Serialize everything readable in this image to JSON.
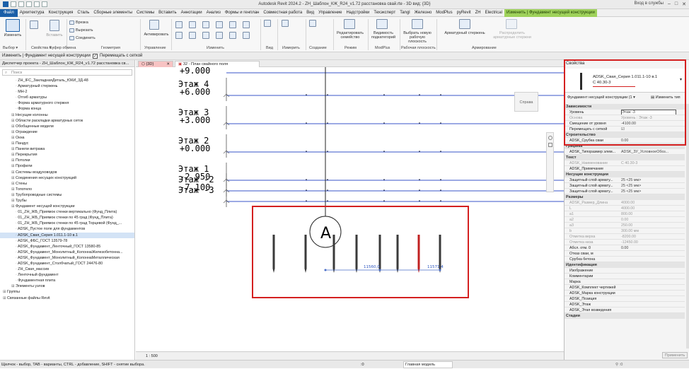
{
  "window": {
    "title": "Autodesk Revit 2024.2 - ZH_Шаблон_КЖ_R24_v1.72 расстановка свай.rte - 3D вид: {3D}",
    "signin": "Вход в службы"
  },
  "menu": [
    "Файл",
    "Архитектура",
    "Конструкция",
    "Сталь",
    "Сборные элементы",
    "Системы",
    "Вставить",
    "Аннотации",
    "Анализ",
    "Формы и генплан",
    "Совместная работа",
    "Вид",
    "Управление",
    "Надстройки",
    "Техэксперт",
    "Tangl",
    "Железно",
    "ModPlus",
    "pyRevit",
    "ZH",
    "Electrical",
    "Изменить | Фундамент несущей конструкции"
  ],
  "ribbon": {
    "modify": "Изменить",
    "paste": "Вставить",
    "cut": "Вырезать",
    "join": "Соединить",
    "cope": "Врезка",
    "activate": "Активировать",
    "groups": {
      "select": "Выбор",
      "properties": "Свойства",
      "clipboard": "Буфер обмена",
      "geometry": "Геометрия",
      "control": "Управление",
      "modify": "Изменить",
      "view": "Вид",
      "measure": "Измерить",
      "create": "Создание",
      "mode": "Режим",
      "modplus": "ModPlus",
      "workplane": "Рабочая плоскость",
      "reinforcement": "Армирование"
    },
    "edit_family": "Редактировать семейство",
    "host_visibility": "Видимость подкатегорий",
    "pick_plane": "Выбрать новую рабочую плоскость",
    "rebar": "Арматурный стержень",
    "distribute_rebar": "Распределить арматурные стержни"
  },
  "context_bar": {
    "label": "Изменить | Фундамент несущей конструкции",
    "checkbox": "Перемещать с сеткой",
    "checked": true
  },
  "browser": {
    "title": "Диспетчер проекта - ZH_Шаблон_КЖ_R24_v1.72 расстановка св...",
    "search_placeholder": "Поиск",
    "items": [
      {
        "text": "ZH_IFC_ЗакладнаяДеталь_ЮКИ_3Д-48",
        "indent": 3
      },
      {
        "text": "Арматурный стержень",
        "indent": 3
      },
      {
        "text": "МН-2",
        "indent": 3
      },
      {
        "text": "Отгиб арматуры",
        "indent": 3
      },
      {
        "text": "Форма арматурного стержня",
        "indent": 3
      },
      {
        "text": "Форма конца",
        "indent": 3
      },
      {
        "text": "Несущие колонны",
        "indent": 2
      },
      {
        "text": "Области раскладки арматурных сеток",
        "indent": 2
      },
      {
        "text": "Обобщенные модели",
        "indent": 2
      },
      {
        "text": "Ограждение",
        "indent": 2
      },
      {
        "text": "Окна",
        "indent": 2
      },
      {
        "text": "Пандус",
        "indent": 2
      },
      {
        "text": "Панели витража",
        "indent": 2
      },
      {
        "text": "Перекрытия",
        "indent": 2
      },
      {
        "text": "Потолки",
        "indent": 2
      },
      {
        "text": "Профили",
        "indent": 2
      },
      {
        "text": "Системы воздуховодов",
        "indent": 2
      },
      {
        "text": "Соединения несущих конструкций",
        "indent": 2
      },
      {
        "text": "Стены",
        "indent": 2
      },
      {
        "text": "Топотело",
        "indent": 2
      },
      {
        "text": "Трубопроводные системы",
        "indent": 2
      },
      {
        "text": "Трубы",
        "indent": 2
      },
      {
        "text": "Фундамент несущей конструкции",
        "indent": 2
      },
      {
        "text": "01_ZH_ЖБ_Приямок стенки вертикально (Фунд_Плита)",
        "indent": 3
      },
      {
        "text": "01_ZH_ЖБ_Приямок стенки по 45 град (Фунд_Плита)",
        "indent": 3
      },
      {
        "text": "01_ZH_ЖБ_Приямок стенки по 45 град Торцевой (Фунд_...",
        "indent": 3
      },
      {
        "text": "ADSK_Пустое поле для фундаментов",
        "indent": 3
      },
      {
        "text": "ADSK_Свая_Серия 1.011.1-10 в.1",
        "indent": 3,
        "selected": true
      },
      {
        "text": "ADSK_ФБС_ГОСТ 13579-78",
        "indent": 3
      },
      {
        "text": "ADSK_Фундамент_Ленточный_ГОСТ 13580-85",
        "indent": 3
      },
      {
        "text": "ADSK_Фундамент_Монолитный_КолоннаЖелезобетонна...",
        "indent": 3
      },
      {
        "text": "ADSK_Фундамент_Монолитный_КолоннаМеталлическая",
        "indent": 3
      },
      {
        "text": "ADSK_Фундамент_Столбчатый_ГОСТ 24476-80",
        "indent": 3
      },
      {
        "text": "ZH_Свая_массив",
        "indent": 3
      },
      {
        "text": "Ленточный фундамент",
        "indent": 3
      },
      {
        "text": "Фундаментная плита",
        "indent": 3
      },
      {
        "text": "Элементы узлов",
        "indent": 2
      },
      {
        "text": "Группы",
        "indent": 0
      },
      {
        "text": "Связанные файлы Revit",
        "indent": 0
      }
    ]
  },
  "tabs": [
    "{3D}",
    "32 - План свайного поля"
  ],
  "canvas": {
    "levels": [
      {
        "name": "Этаж 4",
        "elev": "+6.000"
      },
      {
        "name": "Этаж 3",
        "elev": "+3.000"
      },
      {
        "name": "Этаж 2",
        "elev": "+0.000"
      },
      {
        "name": "Этаж 1",
        "elev": "-2.950"
      },
      {
        "name": "Этаж -2",
        "elev": "-7.100"
      },
      {
        "name": "Этаж -3",
        "elev": ""
      }
    ],
    "top_elev": "+9.000",
    "viewcube": "Справа",
    "grid_bubble": "A",
    "dim1": "11560,0",
    "dim2": "11571,4"
  },
  "view_status": {
    "scale": "1 : 500"
  },
  "status": {
    "hint": "Щелчок - выбор, TAB - варианты, CTRL - добавление, SHIFT - снятие выбора.",
    "model": "Главная модель",
    "zero": ":0"
  },
  "properties": {
    "title": "Свойства",
    "type_name": "ADSK_Свая_Серия 1.011.1-10 в.1",
    "type_sub": "С 40.30-3",
    "category": "Фундамент несущей конструкции (1",
    "edit_type": "Изменить тип",
    "apply": "Применить",
    "sections": [
      {
        "name": "Зависимости",
        "rows": [
          {
            "k": "Уровень",
            "v": "Этаж -3"
          },
          {
            "k": "Основа",
            "v": "Уровень : Этаж -3",
            "g": true
          },
          {
            "k": "Смещение от уровня",
            "v": "-4100.00"
          },
          {
            "k": "Перемещать с сеткой",
            "v": "☑"
          }
        ]
      },
      {
        "name": "Строительство",
        "rows": [
          {
            "k": "ADSK_Срубка сваи",
            "v": "0.00"
          }
        ]
      },
      {
        "name": "Графика",
        "rows": [
          {
            "k": "ADSK_Типоразмер элем...",
            "v": "ADSK_ЗУ_УсловноеОбоз..."
          }
        ]
      },
      {
        "name": "Текст",
        "rows": [
          {
            "k": "ADSK_Наименование",
            "v": "С 40.30-3",
            "g": true
          },
          {
            "k": "ADSK_Примечание",
            "v": ""
          }
        ]
      },
      {
        "name": "Несущие конструкции",
        "rows": [
          {
            "k": "Защитный слой армату...",
            "v": "25 <25 мм>"
          },
          {
            "k": "Защитный слой армату...",
            "v": "25 <25 мм>"
          },
          {
            "k": "Защитный слой армату...",
            "v": "25 <25 мм>"
          }
        ]
      },
      {
        "name": "Размеры",
        "rows": [
          {
            "k": "ADSK_Размер_Длина",
            "v": "4000.00",
            "g": true
          },
          {
            "k": "L",
            "v": "4000.00",
            "g": true
          },
          {
            "k": "a1",
            "v": "800.00",
            "g": true
          },
          {
            "k": "a2",
            "v": "0.00",
            "g": true
          },
          {
            "k": "a3",
            "v": "250.00",
            "g": true
          },
          {
            "k": "b",
            "v": "300.00 мм",
            "g": true
          },
          {
            "k": "Отметка верха",
            "v": "-8200.00",
            "g": true
          },
          {
            "k": "Отметка низа",
            "v": "-12450.00",
            "g": true
          },
          {
            "k": "Абсл. отм. 0",
            "v": "0.00"
          },
          {
            "k": "Отказ сваи, м",
            "v": ""
          },
          {
            "k": "Срубка бетона",
            "v": ""
          }
        ]
      },
      {
        "name": "Идентификация",
        "rows": [
          {
            "k": "Изображение",
            "v": ""
          },
          {
            "k": "Комментарии",
            "v": ""
          },
          {
            "k": "Марка",
            "v": ""
          },
          {
            "k": "ADSK_Комплект чертежей",
            "v": ""
          },
          {
            "k": "ADSK_Марка конструкции",
            "v": ""
          },
          {
            "k": "ADSK_Позиция",
            "v": ""
          },
          {
            "k": "ADSK_Этаж",
            "v": ""
          },
          {
            "k": "ADSK_Этап возведения",
            "v": ""
          }
        ]
      },
      {
        "name": "Стадии",
        "rows": []
      }
    ]
  },
  "colors": {
    "accent": "#d42020",
    "file_tab": "#1b5fa8",
    "context_tab": "#9fd25b",
    "level_line": "#3856c8"
  }
}
